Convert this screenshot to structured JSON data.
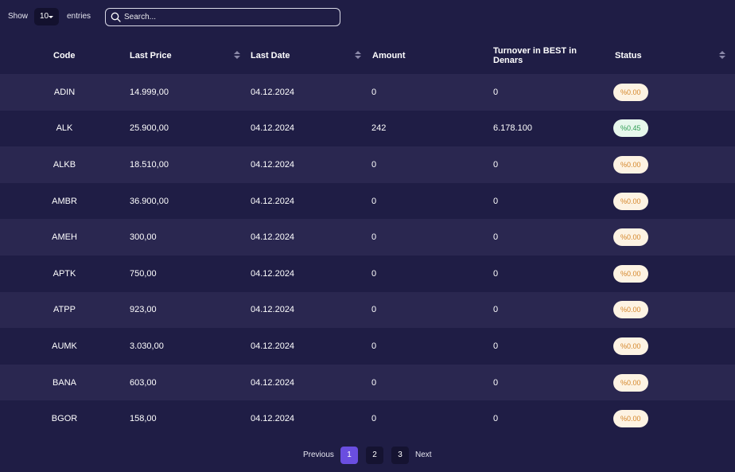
{
  "controls": {
    "show_label": "Show",
    "page_size": "10",
    "entries_label": "entries",
    "search_placeholder": "Search..."
  },
  "table": {
    "columns": [
      "Code",
      "Last Price",
      "Last Date",
      "Amount",
      "Turnover in BEST in Denars",
      "Status"
    ],
    "rows": [
      {
        "code": "ADIN",
        "last_price": "14.999,00",
        "last_date": "04.12.2024",
        "amount": "0",
        "turnover": "0",
        "status": "%0.00",
        "status_kind": "neutral"
      },
      {
        "code": "ALK",
        "last_price": "25.900,00",
        "last_date": "04.12.2024",
        "amount": "242",
        "turnover": "6.178.100",
        "status": "%0.45",
        "status_kind": "up"
      },
      {
        "code": "ALKB",
        "last_price": "18.510,00",
        "last_date": "04.12.2024",
        "amount": "0",
        "turnover": "0",
        "status": "%0.00",
        "status_kind": "neutral"
      },
      {
        "code": "AMBR",
        "last_price": "36.900,00",
        "last_date": "04.12.2024",
        "amount": "0",
        "turnover": "0",
        "status": "%0.00",
        "status_kind": "neutral"
      },
      {
        "code": "AMEH",
        "last_price": "300,00",
        "last_date": "04.12.2024",
        "amount": "0",
        "turnover": "0",
        "status": "%0.00",
        "status_kind": "neutral"
      },
      {
        "code": "APTK",
        "last_price": "750,00",
        "last_date": "04.12.2024",
        "amount": "0",
        "turnover": "0",
        "status": "%0.00",
        "status_kind": "neutral"
      },
      {
        "code": "ATPP",
        "last_price": "923,00",
        "last_date": "04.12.2024",
        "amount": "0",
        "turnover": "0",
        "status": "%0.00",
        "status_kind": "neutral"
      },
      {
        "code": "AUMK",
        "last_price": "3.030,00",
        "last_date": "04.12.2024",
        "amount": "0",
        "turnover": "0",
        "status": "%0.00",
        "status_kind": "neutral"
      },
      {
        "code": "BANA",
        "last_price": "603,00",
        "last_date": "04.12.2024",
        "amount": "0",
        "turnover": "0",
        "status": "%0.00",
        "status_kind": "neutral"
      },
      {
        "code": "BGOR",
        "last_price": "158,00",
        "last_date": "04.12.2024",
        "amount": "0",
        "turnover": "0",
        "status": "%0.00",
        "status_kind": "neutral"
      }
    ]
  },
  "pagination": {
    "previous": "Previous",
    "pages": [
      "1",
      "2",
      "3"
    ],
    "active_page": "1",
    "next": "Next"
  },
  "colors": {
    "background": "#1f1d45",
    "row_alt": "#2a2750",
    "accent": "#6a4ee0",
    "badge_neutral_bg": "#fdf3e3",
    "badge_neutral_text": "#d4862a",
    "badge_up_bg": "#e6f7ec",
    "badge_up_text": "#2f9e54"
  },
  "icons": {
    "search": "search-icon",
    "dropdown": "chevron-down-icon",
    "sort": "sort-icon"
  }
}
